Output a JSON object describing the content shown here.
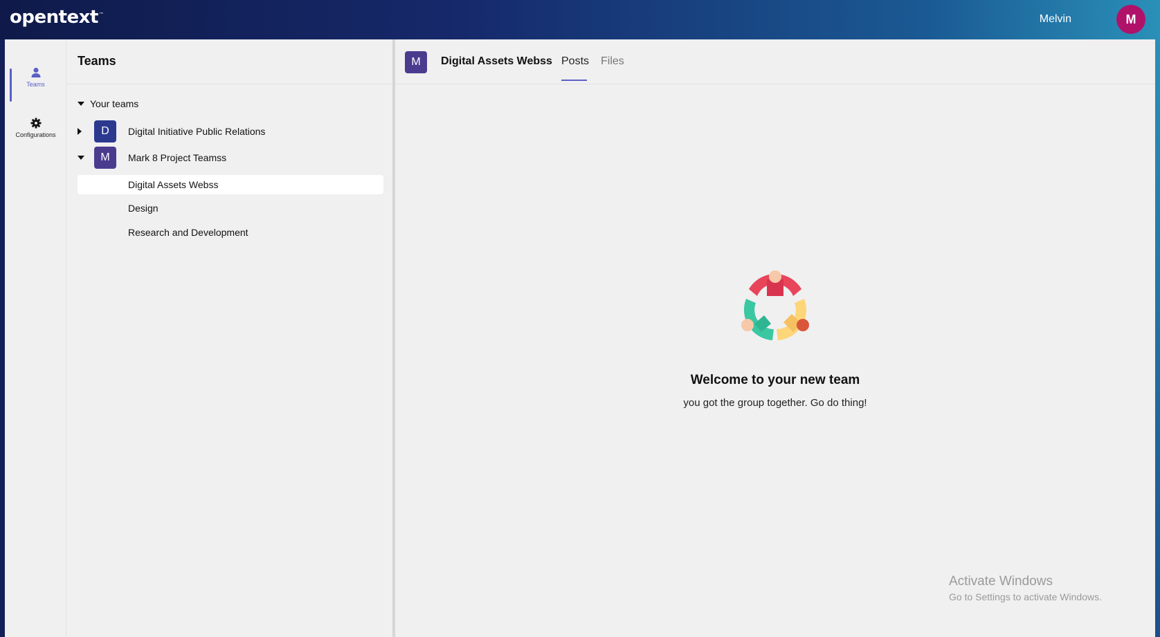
{
  "header": {
    "brand": "opentext",
    "brand_tm": "™",
    "user_name": "Melvin",
    "user_initial": "M",
    "user_avatar_color": "#b0126a"
  },
  "rail": {
    "items": [
      {
        "label": "Teams",
        "icon": "person-icon",
        "active": true
      },
      {
        "label": "Configurations",
        "icon": "gear-icon",
        "active": false
      }
    ],
    "accent": "#5b5fc7"
  },
  "teams_panel": {
    "title": "Teams",
    "section_label": "Your teams",
    "teams": [
      {
        "initial": "D",
        "name": "Digital Initiative Public Relations",
        "color": "#2b3a8f",
        "expanded": false
      },
      {
        "initial": "M",
        "name": "Mark 8 Project Teamss",
        "color": "#4b3b8f",
        "expanded": true
      }
    ],
    "channels": [
      {
        "name": "Digital Assets Webss",
        "selected": true
      },
      {
        "name": "Design",
        "selected": false
      },
      {
        "name": "Research and Development",
        "selected": false
      }
    ]
  },
  "main": {
    "channel_initial": "M",
    "channel_title": "Digital Assets Webss",
    "tabs": [
      {
        "label": "Posts",
        "active": true
      },
      {
        "label": "Files",
        "active": false
      }
    ],
    "welcome_title": "Welcome to your new team",
    "welcome_subtitle": "you got the group together. Go do thing!",
    "welcome_icon": "team-circle-illustration"
  },
  "watermark": {
    "line1": "Activate Windows",
    "line2": "Go to Settings to activate Windows."
  }
}
